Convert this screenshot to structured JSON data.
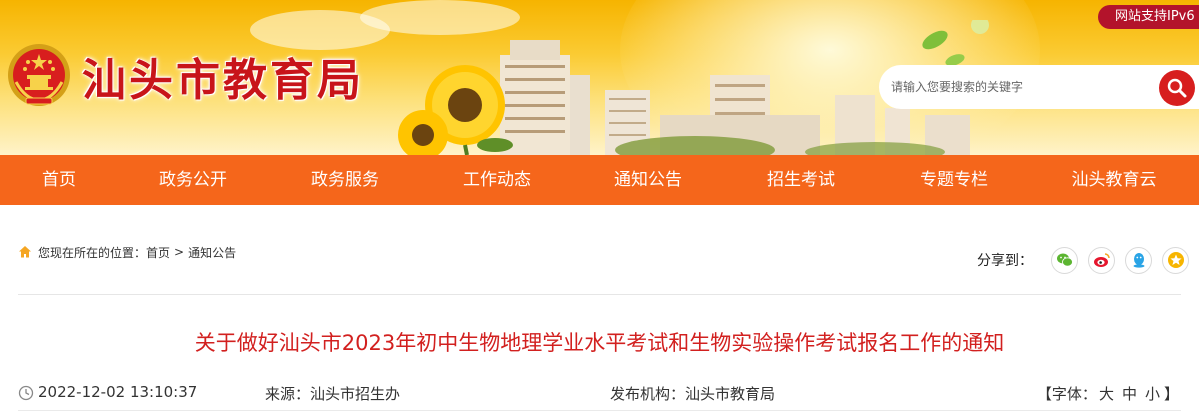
{
  "site": {
    "title": "汕头市教育局",
    "ipv6_badge": "网站支持IPv6"
  },
  "search": {
    "placeholder": "请输入您要搜索的关键字"
  },
  "nav": {
    "items": [
      {
        "label": "首页"
      },
      {
        "label": "政务公开"
      },
      {
        "label": "政务服务"
      },
      {
        "label": "工作动态"
      },
      {
        "label": "通知公告"
      },
      {
        "label": "招生考试"
      },
      {
        "label": "专题专栏"
      },
      {
        "label": "汕头教育云"
      }
    ]
  },
  "breadcrumb": {
    "prefix": "您现在所在的位置：",
    "home": "首页",
    "separator": ">",
    "current": "通知公告"
  },
  "share": {
    "label": "分享到：",
    "buttons": [
      "wechat-icon",
      "weibo-icon",
      "qq-icon",
      "favorite-icon"
    ]
  },
  "article": {
    "title": "关于做好汕头市2023年初中生物地理学业水平考试和生物实验操作考试报名工作的通知",
    "date": "2022-12-02 13:10:37",
    "source_label": "来源：",
    "source": "汕头市招生办",
    "publisher_label": "发布机构：",
    "publisher": "汕头市教育局",
    "font_open": "【字体：",
    "font_large": "大",
    "font_medium": "中",
    "font_small": "小",
    "font_close": "】"
  },
  "colors": {
    "nav_bg": "#f5661b",
    "title_red": "#d2201f",
    "brand_red": "#c8141a",
    "search_button": "#d71e1e",
    "ipv6_badge": "#b3132b"
  }
}
